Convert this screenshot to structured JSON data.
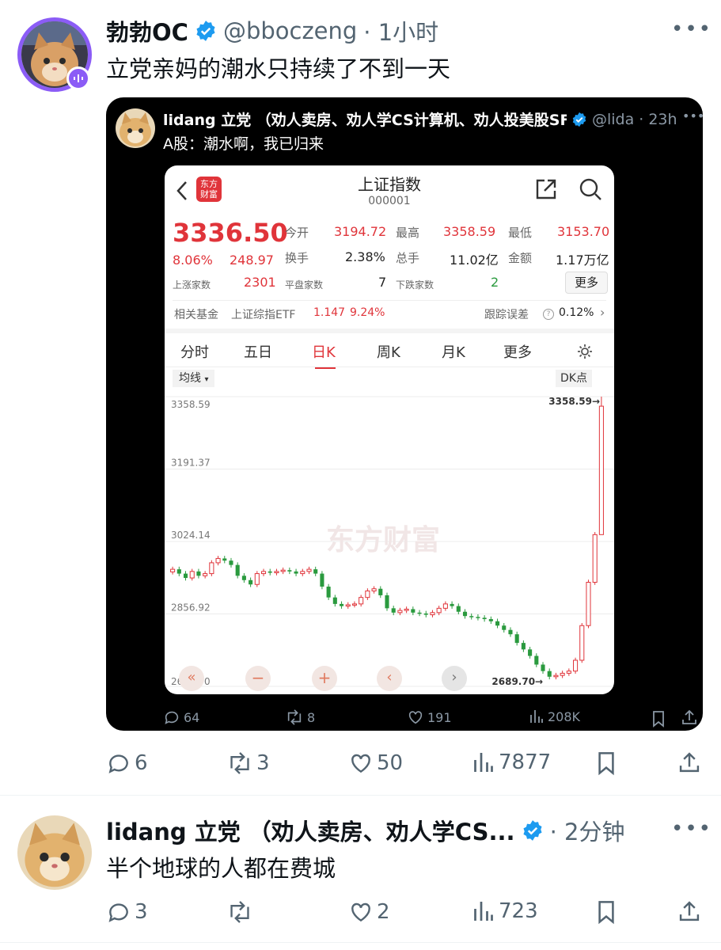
{
  "tweet1": {
    "name": "勃勃OC",
    "handle": "@bboczeng",
    "time": "· 1小时",
    "text": "立党亲妈的潮水只持续了不到一天",
    "actions": {
      "reply": "6",
      "retweet": "3",
      "like": "50",
      "views": "7877"
    }
  },
  "quoted": {
    "name": "lidang 立党 （劝人卖房、劝人学CS计算机、劝人投美股SF",
    "handle": "@lida",
    "time": "· 23h",
    "text": "A股：潮水啊，我已归来",
    "actions": {
      "reply": "64",
      "retweet": "8",
      "like": "191",
      "views": "208K"
    }
  },
  "stock": {
    "logo": "东方财富",
    "title": "上证指数",
    "code": "000001",
    "price": "3336.50",
    "pct": "8.06%",
    "change": "248.97",
    "open_label": "今开",
    "open": "3194.72",
    "high_label": "最高",
    "high": "3358.59",
    "low_label": "最低",
    "low": "3153.70",
    "turnover_label": "换手",
    "turnover": "2.38%",
    "volume_label": "总手",
    "volume": "11.02亿",
    "amount_label": "金额",
    "amount": "1.17万亿",
    "up_label": "上涨家数",
    "up": "2301",
    "flat_label": "平盘家数",
    "flat": "7",
    "down_label": "下跌家数",
    "down": "2",
    "more_button": "更多",
    "fund_label": "相关基金",
    "fund_name": "上证综指ETF",
    "fund_price": "1.147",
    "fund_pct": "9.24%",
    "error_label": "跟踪误差",
    "error_value": "0.12%",
    "tabs": [
      "分时",
      "五日",
      "日K",
      "周K",
      "月K",
      "更多"
    ],
    "ma_label": "均线",
    "dk_label": "DK点",
    "watermark": "东方财富",
    "y_labels": [
      "3358.59",
      "3191.37",
      "3024.14",
      "2856.92",
      "2689.70"
    ],
    "high_marker": "3358.59",
    "low_marker": "2689.70",
    "accent": "#e0343a",
    "up_color": "#e0343a",
    "down_color": "#2a9a3e"
  },
  "chart_data": {
    "type": "candlestick",
    "ylim": [
      2689.7,
      3358.59
    ],
    "y_ticks": [
      3358.59,
      3191.37,
      3024.14,
      2856.92,
      2689.7
    ],
    "close": [
      2960,
      2950,
      2940,
      2955,
      2945,
      2950,
      2975,
      2985,
      2980,
      2970,
      2945,
      2935,
      2925,
      2950,
      2955,
      2952,
      2955,
      2958,
      2955,
      2950,
      2955,
      2960,
      2950,
      2920,
      2895,
      2880,
      2875,
      2878,
      2880,
      2895,
      2910,
      2915,
      2900,
      2870,
      2860,
      2865,
      2868,
      2860,
      2858,
      2855,
      2860,
      2870,
      2880,
      2875,
      2862,
      2852,
      2850,
      2848,
      2845,
      2840,
      2830,
      2820,
      2810,
      2790,
      2775,
      2760,
      2740,
      2725,
      2712,
      2715,
      2720,
      2725,
      2750,
      2830,
      2930,
      3040,
      3336.5
    ]
  },
  "tweet2": {
    "name": "lidang 立党 （劝人卖房、劝人学CS...",
    "time": "· 2分钟",
    "text": "半个地球的人都在费城",
    "actions": {
      "reply": "3",
      "like": "2",
      "views": "723"
    }
  }
}
